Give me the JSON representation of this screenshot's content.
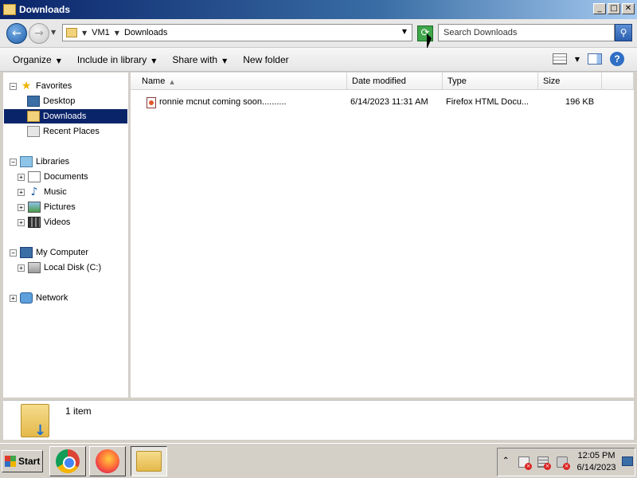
{
  "window": {
    "title": "Downloads",
    "buttons": {
      "minimize": "_",
      "maximize": "□",
      "close": "✕"
    }
  },
  "address": {
    "crumbs": [
      "VM1",
      "Downloads"
    ],
    "search_placeholder": "Search Downloads"
  },
  "toolbar": {
    "organize": "Organize",
    "include_in_library": "Include in library",
    "share_with": "Share with",
    "new_folder": "New folder"
  },
  "nav": {
    "favorites": "Favorites",
    "desktop": "Desktop",
    "downloads": "Downloads",
    "recent_places": "Recent Places",
    "libraries": "Libraries",
    "documents": "Documents",
    "music": "Music",
    "pictures": "Pictures",
    "videos": "Videos",
    "my_computer": "My Computer",
    "local_disk": "Local Disk (C:)",
    "network": "Network"
  },
  "columns": {
    "name": "Name",
    "date_modified": "Date modified",
    "type": "Type",
    "size": "Size"
  },
  "files": [
    {
      "name": "ronnie mcnut coming soon..........",
      "date_modified": "6/14/2023 11:31 AM",
      "type": "Firefox HTML Docu...",
      "size": "196 KB"
    }
  ],
  "details": {
    "item_count": "1 item"
  },
  "taskbar": {
    "start": "Start",
    "time": "12:05 PM",
    "date": "6/14/2023"
  },
  "colors": {
    "titlebar": "#0a246a",
    "selection": "#0a246a",
    "taskbar": "#d4d0c8"
  }
}
